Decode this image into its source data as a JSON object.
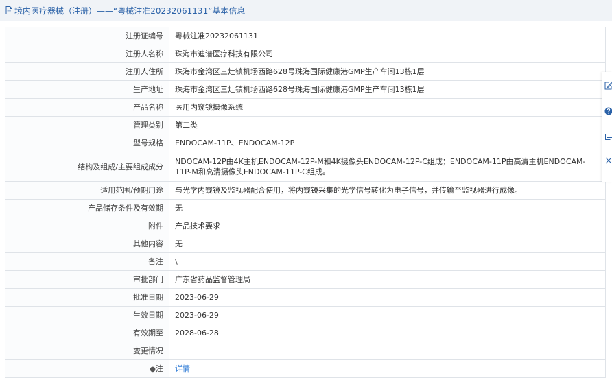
{
  "header": {
    "title": "境内医疗器械（注册）——“粤械注准20232061131”基本信息"
  },
  "rows": [
    {
      "label": "注册证编号",
      "value": "粤械注准20232061131"
    },
    {
      "label": "注册人名称",
      "value": "珠海市迪谱医疗科技有限公司"
    },
    {
      "label": "注册人住所",
      "value": "珠海市金湾区三灶镇机场西路628号珠海国际健康港GMP生产车间13栋1层"
    },
    {
      "label": "生产地址",
      "value": "珠海市金湾区三灶镇机场西路628号珠海国际健康港GMP生产车间13栋1层"
    },
    {
      "label": "产品名称",
      "value": "医用内窥镜摄像系统"
    },
    {
      "label": "管理类别",
      "value": "第二类"
    },
    {
      "label": "型号规格",
      "value": "ENDOCAM-11P、ENDOCAM-12P"
    },
    {
      "label": "结构及组成/主要组成成分",
      "value": "NDOCAM-12P由4K主机ENDOCAM-12P-M和4K摄像头ENDOCAM-12P-C组成；ENDOCAM-11P由高清主机ENDOCAM-11P-M和高清摄像头ENDOCAM-11P-C组成。"
    },
    {
      "label": "适用范围/预期用途",
      "value": "与光学内窥镜及监视器配合使用，将内窥镜采集的光学信号转化为电子信号，并传输至监视器进行成像。"
    },
    {
      "label": "产品储存条件及有效期",
      "value": "无"
    },
    {
      "label": "附件",
      "value": "产品技术要求"
    },
    {
      "label": "其他内容",
      "value": "无"
    },
    {
      "label": "备注",
      "value": "\\"
    },
    {
      "label": "审批部门",
      "value": "广东省药品监督管理局"
    },
    {
      "label": "批准日期",
      "value": "2023-06-29"
    },
    {
      "label": "生效日期",
      "value": "2023-06-29"
    },
    {
      "label": "有效期至",
      "value": "2028-06-28"
    },
    {
      "label": "变更情况",
      "value": ""
    }
  ],
  "note_row": {
    "pin_icon": "●",
    "label": "注",
    "link_text": "详情"
  },
  "side_toolbar": {
    "icons": [
      "edit-icon",
      "help-icon",
      "copy-icon",
      "close-icon"
    ]
  },
  "colors": {
    "title": "#2b62a8",
    "link": "#2e7bd6",
    "border": "#dfe3e8",
    "header_bg": "#f0f3f7"
  }
}
